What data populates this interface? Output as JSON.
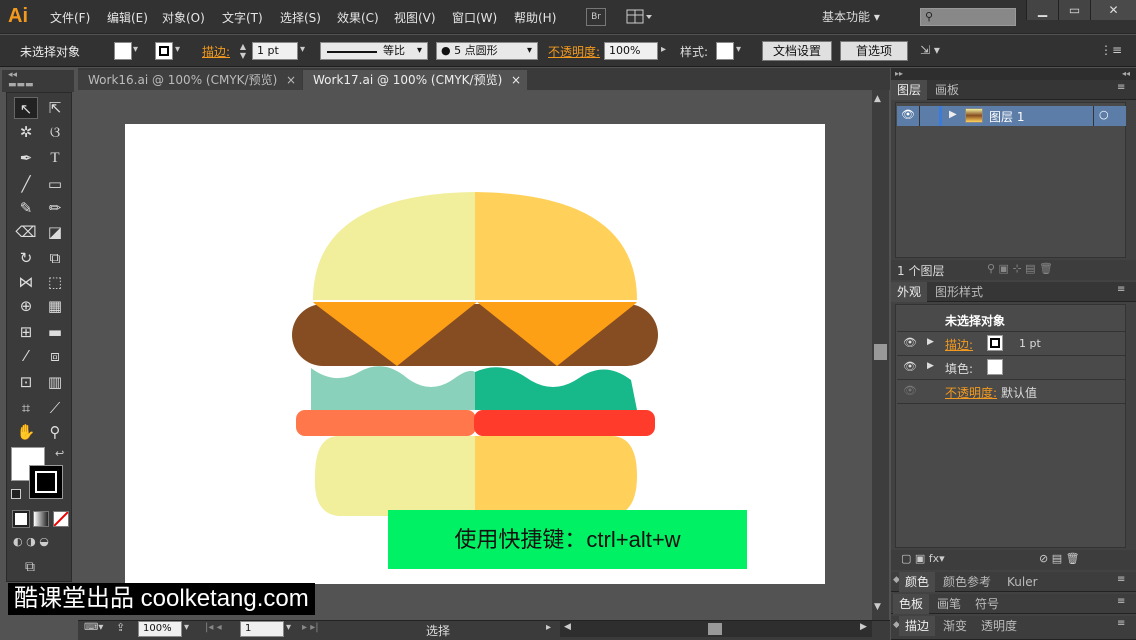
{
  "app": {
    "logo": "Ai"
  },
  "menus": [
    "文件(F)",
    "编辑(E)",
    "对象(O)",
    "文字(T)",
    "选择(S)",
    "效果(C)",
    "视图(V)",
    "窗口(W)",
    "帮助(H)"
  ],
  "bridge_label": "Br",
  "workspace": "基本功能",
  "control": {
    "selection": "未选择对象",
    "stroke_label": "描边:",
    "stroke_value": "1 pt",
    "stroke_profile": "等比",
    "brush": "5 点圆形",
    "opacity_label": "不透明度:",
    "opacity_value": "100%",
    "style_label": "样式:",
    "doc_settings": "文档设置",
    "preferences": "首选项"
  },
  "tabs": [
    {
      "label": "Work16.ai @ 100% (CMYK/预览)",
      "close": "×"
    },
    {
      "label": "Work17.ai @ 100% (CMYK/预览)",
      "close": "×"
    }
  ],
  "canvas": {
    "caption": "使用快捷键：ctrl+alt+w",
    "watermark": "酷课堂出品 coolketang.com"
  },
  "status": {
    "zoom": "100%",
    "page": "1",
    "mode": "选择"
  },
  "layers_panel": {
    "tabs": [
      "图层",
      "画板"
    ],
    "layer_name": "图层 1",
    "count": "1 个图层"
  },
  "appearance_panel": {
    "tabs": [
      "外观",
      "图形样式"
    ],
    "title": "未选择对象",
    "stroke_label": "描边:",
    "stroke_value": "1 pt",
    "fill_label": "填色:",
    "opacity_label": "不透明度:",
    "opacity_value": "默认值"
  },
  "color_panel_tabs": [
    "颜色",
    "颜色参考",
    "Kuler"
  ],
  "swatch_panel_tabs": [
    "色板",
    "画笔",
    "符号"
  ],
  "stroke_panel_tabs": [
    "描边",
    "渐变",
    "透明度"
  ],
  "colors": {
    "accent": "#f39a1e",
    "caption_bg": "#00f264",
    "layer_select": "#5c7da8"
  }
}
